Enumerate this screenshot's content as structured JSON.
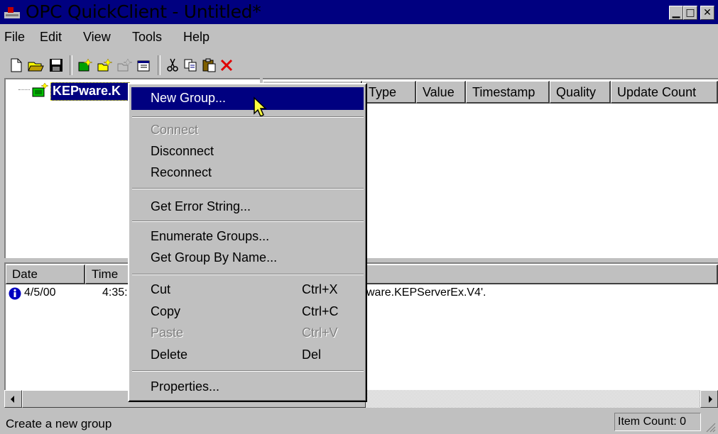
{
  "window": {
    "title": "OPC QuickClient - Untitled*",
    "icon": "app-icon",
    "controls": [
      "minimize",
      "maximize",
      "close"
    ]
  },
  "menubar": {
    "items": [
      "File",
      "Edit",
      "View",
      "Tools",
      "Help"
    ]
  },
  "toolbar": {
    "buttons": [
      "new-document-icon",
      "open-folder-icon",
      "save-disk-icon",
      "new-server-icon",
      "new-group-icon",
      "new-item-icon",
      "properties-icon",
      "cut-icon",
      "copy-icon",
      "paste-icon",
      "delete-x-icon"
    ]
  },
  "tree": {
    "root_label": "KEPware.K"
  },
  "list": {
    "columns": [
      "Type",
      "Value",
      "Timestamp",
      "Quality",
      "Update Count"
    ]
  },
  "log": {
    "columns": [
      "Date",
      "Time"
    ],
    "rows": [
      {
        "icon": "info-icon",
        "date": "4/5/00",
        "time": "4:35:",
        "message": "ware.KEPServerEx.V4'."
      }
    ]
  },
  "context_menu": {
    "new_group": "New Group...",
    "connect": "Connect",
    "disconnect": "Disconnect",
    "reconnect": "Reconnect",
    "get_error_string": "Get Error String...",
    "enumerate_groups": "Enumerate Groups...",
    "get_group_by_name": "Get Group By Name...",
    "cut": "Cut",
    "cut_key": "Ctrl+X",
    "copy": "Copy",
    "copy_key": "Ctrl+C",
    "paste": "Paste",
    "paste_key": "Ctrl+V",
    "delete": "Delete",
    "delete_key": "Del",
    "properties": "Properties..."
  },
  "statusbar": {
    "text": "Create a new group",
    "item_count": "Item Count: 0"
  },
  "colors": {
    "titlebar": "#000080",
    "face": "#c0c0c0",
    "highlight": "#000080"
  }
}
